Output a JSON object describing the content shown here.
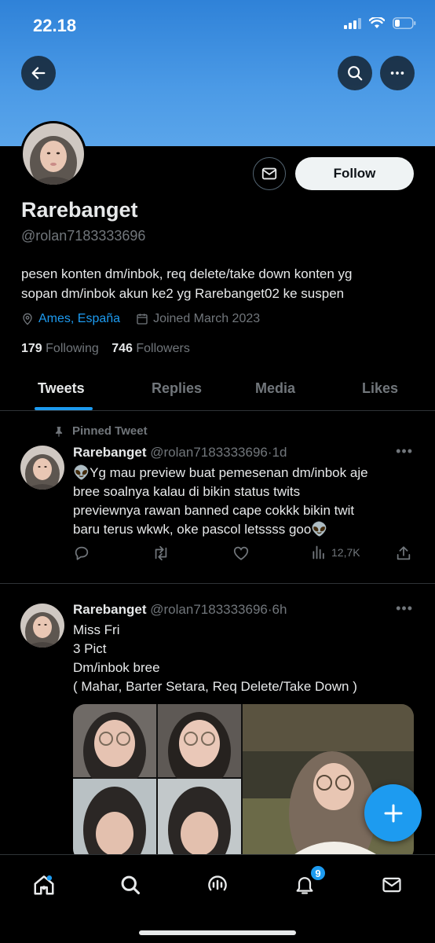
{
  "status_bar": {
    "time": "22.18"
  },
  "profile": {
    "name": "Rarebanget",
    "handle": "@rolan7183333696",
    "bio_lines": [
      "pesen konten dm/inbok, req delete/take down konten yg",
      "sopan dm/inbok akun ke2 yg Rarebanget02 ke suspen"
    ],
    "location": "Ames, España",
    "joined": "Joined March 2023",
    "following_count": "179",
    "following_label": "Following",
    "followers_count": "746",
    "followers_label": "Followers",
    "follow_label": "Follow"
  },
  "tabs": [
    {
      "label": "Tweets",
      "active": true
    },
    {
      "label": "Replies",
      "active": false
    },
    {
      "label": "Media",
      "active": false
    },
    {
      "label": "Likes",
      "active": false
    }
  ],
  "tweets": [
    {
      "pinned_label": "Pinned Tweet",
      "name": "Rarebanget",
      "handle": "@rolan7183333696",
      "time": "1d",
      "text_lines": [
        "👽Yg mau preview buat pemesenan dm/inbok aje",
        "bree soalnya kalau di bikin status twits",
        "previewnya rawan banned cape cokkk bikin twit",
        "baru terus wkwk, oke pascol letssss goo👽"
      ],
      "views": "12,7K"
    },
    {
      "name": "Rarebanget",
      "handle": "@rolan7183333696",
      "time": "6h",
      "text_lines": [
        "Miss Fri",
        "3 Pict",
        "Dm/inbok bree",
        "( Mahar, Barter Setara, Req Delete/Take Down )"
      ]
    }
  ],
  "bottom_nav": {
    "notifications_badge": "9"
  },
  "colors": {
    "accent": "#1d9bf0",
    "banner": "#4b9ae6",
    "background": "#000000"
  }
}
